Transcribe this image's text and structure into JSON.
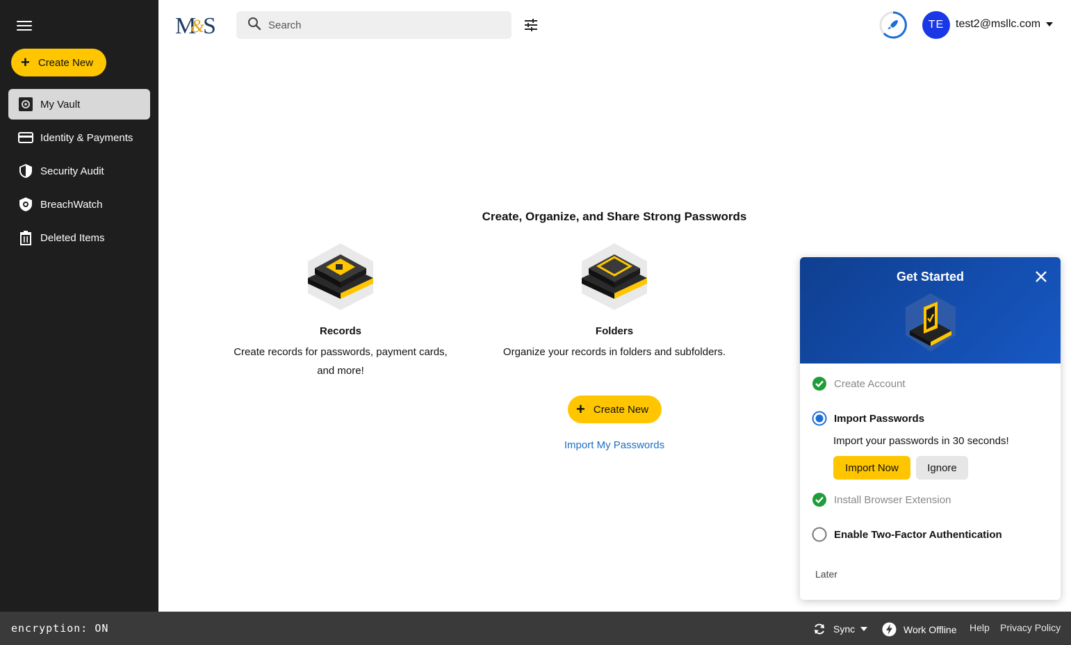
{
  "sidebar": {
    "menu_icon": "hamburger-icon",
    "create_new_label": "Create New",
    "items": [
      {
        "label": "My Vault",
        "icon": "vault-icon",
        "active": true
      },
      {
        "label": "Identity & Payments",
        "icon": "card-icon",
        "active": false
      },
      {
        "label": "Security Audit",
        "icon": "shield-icon",
        "active": false
      },
      {
        "label": "BreachWatch",
        "icon": "breachwatch-icon",
        "active": false
      },
      {
        "label": "Deleted Items",
        "icon": "trash-icon",
        "active": false
      }
    ]
  },
  "header": {
    "logo_text": "M&S",
    "search_placeholder": "Search",
    "avatar_initials": "TE",
    "user_email": "test2@msllc.com"
  },
  "main": {
    "headline": "Create, Organize, and Share Strong Passwords",
    "features": [
      {
        "title": "Records",
        "desc": "Create records for passwords, payment cards, and more!"
      },
      {
        "title": "Folders",
        "desc": "Organize your records in folders and subfolders."
      }
    ],
    "create_new_label": "Create New",
    "import_link": "Import My Passwords"
  },
  "get_started": {
    "title": "Get Started",
    "steps": [
      {
        "label": "Create Account",
        "status": "done"
      },
      {
        "label": "Import Passwords",
        "status": "current"
      },
      {
        "label": "Install Browser Extension",
        "status": "done"
      },
      {
        "label": "Enable Two-Factor Authentication",
        "status": "todo"
      }
    ],
    "import_desc": "Import your passwords in 30 seconds!",
    "import_now": "Import Now",
    "ignore": "Ignore",
    "later": "Later"
  },
  "footer": {
    "encryption": "encryption: ON",
    "sync": "Sync",
    "work_offline": "Work Offline",
    "help": "Help",
    "privacy": "Privacy Policy"
  },
  "colors": {
    "accent_yellow": "#ffc600",
    "sidebar_bg": "#1e1e1e",
    "panel_blue": "#1758c4",
    "link_blue": "#1d6fc4",
    "success_green": "#1f9d3a",
    "avatar_blue": "#1a38e6"
  }
}
